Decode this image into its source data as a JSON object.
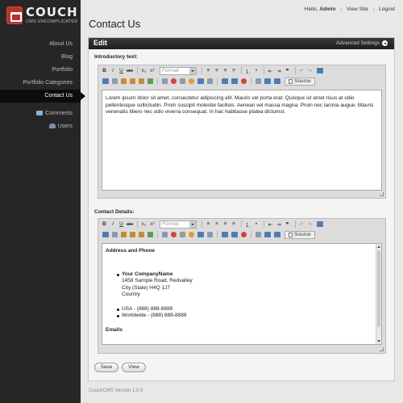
{
  "app": {
    "logo_title": "COUCH",
    "logo_subtitle": "CMS UNCOMPLICATED"
  },
  "topbar": {
    "hello": "Hello,",
    "user": "Admin",
    "view_site": "View Site",
    "logout": "Logout"
  },
  "sidebar": {
    "items": [
      {
        "label": "About Us"
      },
      {
        "label": "Blog"
      },
      {
        "label": "Portfolio"
      },
      {
        "label": "Portfolio Categories"
      },
      {
        "label": "Contact Us",
        "active": true
      }
    ],
    "sub_items": [
      {
        "label": "Comments",
        "icon": "comments-icon"
      },
      {
        "label": "Users",
        "icon": "users-icon"
      }
    ]
  },
  "page": {
    "title": "Contact Us"
  },
  "panel": {
    "title": "Edit",
    "advanced": "Advanced Settings"
  },
  "editor": {
    "format_placeholder": "Format",
    "source_label": "Source"
  },
  "fields": {
    "intro": {
      "label": "Introductory text:",
      "text": "Lorem ipsum dolor sit amet, consectetur adipiscing elit. Mauris vel porta erat. Quisque sit amet risus at odio pellentesque sollicitudin. Proin suscipit molestie facilisis. Aenean vel massa magna. Proin nec lacinia augue. Mauris venenatis libero nec odio viverra consequat. In hac habitasse platea dictumst."
    },
    "contact": {
      "label": "Contact Details:",
      "heading": "Address and Phone",
      "company": "Your CompanyName",
      "street": "1458 Sample Road, Redvalley",
      "city": "City (State) H4Q 1J7",
      "country": "Country",
      "phone_usa": "USA - (888) 888-8888",
      "phone_world": "Worldwide - (888) 888-8888",
      "emails": "Emails"
    }
  },
  "buttons": {
    "save": "Save",
    "view": "View"
  },
  "footer": {
    "version": "CouchCMS Version 1.0.0"
  },
  "colors": {
    "sidebar": "#262626",
    "logo_red": "#b5312b",
    "panel_header": "#2b2b2b"
  }
}
